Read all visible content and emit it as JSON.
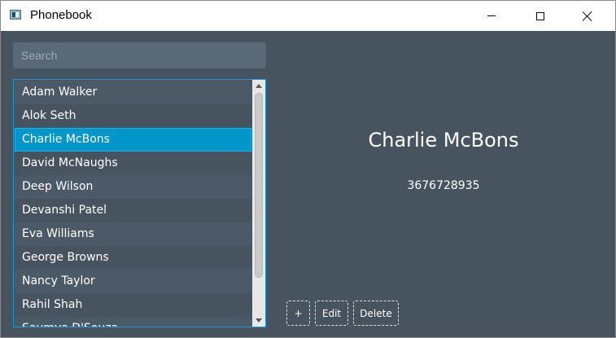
{
  "window": {
    "title": "Phonebook"
  },
  "titlebar_icons": {
    "app": "phonebook-app-icon",
    "minimize": "minimize-icon",
    "maximize": "maximize-icon",
    "close": "close-icon"
  },
  "search": {
    "placeholder": "Search",
    "value": ""
  },
  "contacts": {
    "items": [
      {
        "label": "Adam Walker"
      },
      {
        "label": "Alok Seth"
      },
      {
        "label": "Charlie McBons",
        "selected": true
      },
      {
        "label": "David McNaughs"
      },
      {
        "label": "Deep Wilson"
      },
      {
        "label": "Devanshi Patel"
      },
      {
        "label": "Eva Williams"
      },
      {
        "label": "George Browns"
      },
      {
        "label": "Nancy Taylor"
      },
      {
        "label": "Rahil Shah"
      },
      {
        "label": "Saumya D'Souza"
      }
    ]
  },
  "detail": {
    "name": "Charlie McBons",
    "phone": "3676728935"
  },
  "actions": {
    "add_label": "+",
    "edit_label": "Edit",
    "delete_label": "Delete"
  },
  "colors": {
    "background": "#47535f",
    "selection": "#0096c9",
    "list_border": "#1e9bd7",
    "search_bg": "#5a6977"
  }
}
